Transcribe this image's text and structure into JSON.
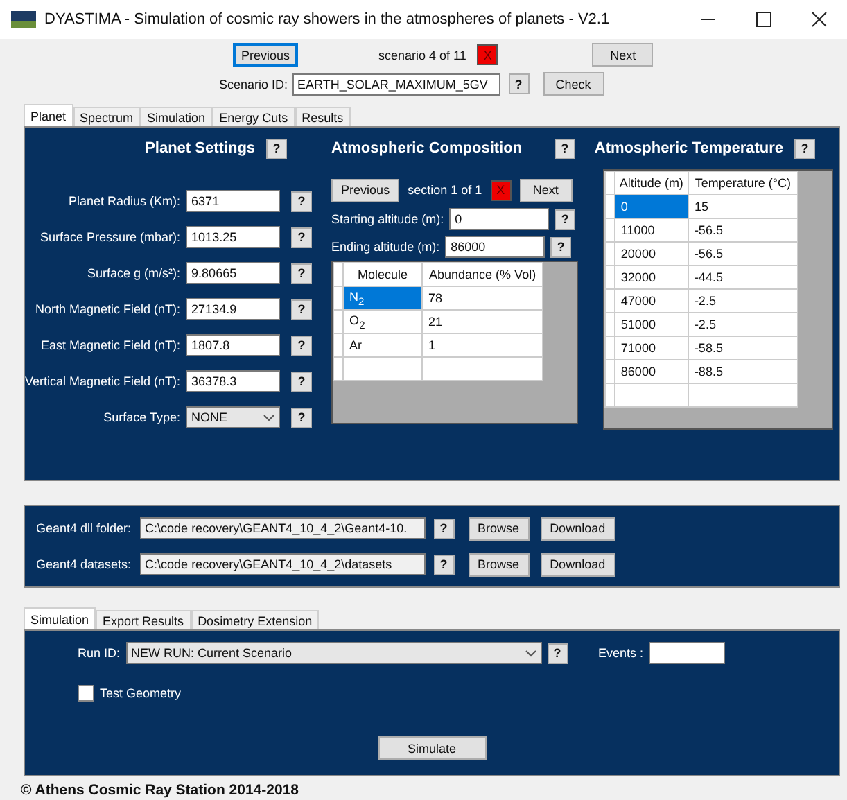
{
  "window": {
    "title": "DYASTIMA - Simulation of cosmic ray showers in the atmospheres of planets - V2.1"
  },
  "scenario": {
    "previous": "Previous",
    "counter": "scenario 4 of 11",
    "delete": "X",
    "next": "Next",
    "id_label": "Scenario ID:",
    "id_value": "EARTH_SOLAR_MAXIMUM_5GV",
    "help": "?",
    "check": "Check"
  },
  "tabs": [
    {
      "label": "Planet",
      "selected": true
    },
    {
      "label": "Spectrum",
      "selected": false
    },
    {
      "label": "Simulation",
      "selected": false
    },
    {
      "label": "Energy Cuts",
      "selected": false
    },
    {
      "label": "Results",
      "selected": false
    }
  ],
  "planet_settings": {
    "title": "Planet Settings",
    "help": "?",
    "fields": [
      {
        "kind": "text",
        "label": "Planet Radius (Km):",
        "value": "6371",
        "help": "?"
      },
      {
        "kind": "text",
        "label": "Surface Pressure (mbar):",
        "value": "1013.25",
        "help": "?"
      },
      {
        "kind": "text",
        "label": "Surface g (m/s²):",
        "value": "9.80665",
        "help": "?"
      },
      {
        "kind": "text",
        "label": "North Magnetic Field (nT):",
        "value": "27134.9",
        "help": "?"
      },
      {
        "kind": "text",
        "label": "East Magnetic Field (nT):",
        "value": "1807.8",
        "help": "?"
      },
      {
        "kind": "text",
        "label": "Vertical Magnetic Field (nT):",
        "value": "36378.3",
        "help": "?"
      },
      {
        "kind": "select",
        "label": "Surface Type:",
        "value": "NONE",
        "help": "?"
      }
    ]
  },
  "composition": {
    "title": "Atmospheric Composition",
    "help": "?",
    "previous": "Previous",
    "counter": "section 1 of 1",
    "delete": "X",
    "next": "Next",
    "altitudes": [
      {
        "label": "Starting altitude (m):",
        "value": "0",
        "help": "?"
      },
      {
        "label": "Ending altitude (m):",
        "value": "86000",
        "help": "?"
      }
    ],
    "columns": [
      "Molecule",
      "Abundance (% Vol)"
    ],
    "rows": [
      {
        "molecule": "N$_{2}$",
        "abundance": "78",
        "selected": true
      },
      {
        "molecule": "O$_{2}$",
        "abundance": "21",
        "selected": false
      },
      {
        "molecule": "Ar",
        "abundance": "1",
        "selected": false
      }
    ]
  },
  "temperature": {
    "title": "Atmospheric Temperature",
    "help": "?",
    "columns": [
      "Altitude (m)",
      "Temperature (°C)"
    ],
    "rows": [
      {
        "altitude": "0",
        "temperature": "15",
        "selected": true
      },
      {
        "altitude": "11000",
        "temperature": "-56.5",
        "selected": false
      },
      {
        "altitude": "20000",
        "temperature": "-56.5",
        "selected": false
      },
      {
        "altitude": "32000",
        "temperature": "-44.5",
        "selected": false
      },
      {
        "altitude": "47000",
        "temperature": "-2.5",
        "selected": false
      },
      {
        "altitude": "51000",
        "temperature": "-2.5",
        "selected": false
      },
      {
        "altitude": "71000",
        "temperature": "-58.5",
        "selected": false
      },
      {
        "altitude": "86000",
        "temperature": "-88.5",
        "selected": false
      }
    ]
  },
  "geant4": [
    {
      "label": "Geant4 dll folder:",
      "value": "C:\\code recovery\\GEANT4_10_4_2\\Geant4-10.",
      "help": "?",
      "browse": "Browse",
      "download": "Download"
    },
    {
      "label": "Geant4 datasets:",
      "value": "C:\\code recovery\\GEANT4_10_4_2\\datasets",
      "help": "?",
      "browse": "Browse",
      "download": "Download"
    }
  ],
  "bottom_tabs": [
    {
      "label": "Simulation",
      "selected": true
    },
    {
      "label": "Export Results",
      "selected": false
    },
    {
      "label": "Dosimetry Extension",
      "selected": false
    }
  ],
  "run": {
    "label": "Run ID:",
    "value": "NEW RUN: Current Scenario",
    "help": "?",
    "events_label": "Events :",
    "test_geometry": {
      "label": "Test Geometry",
      "checked": false
    },
    "simulate": "Simulate"
  },
  "footer": "© Athens Cosmic Ray Station 2014-2018"
}
